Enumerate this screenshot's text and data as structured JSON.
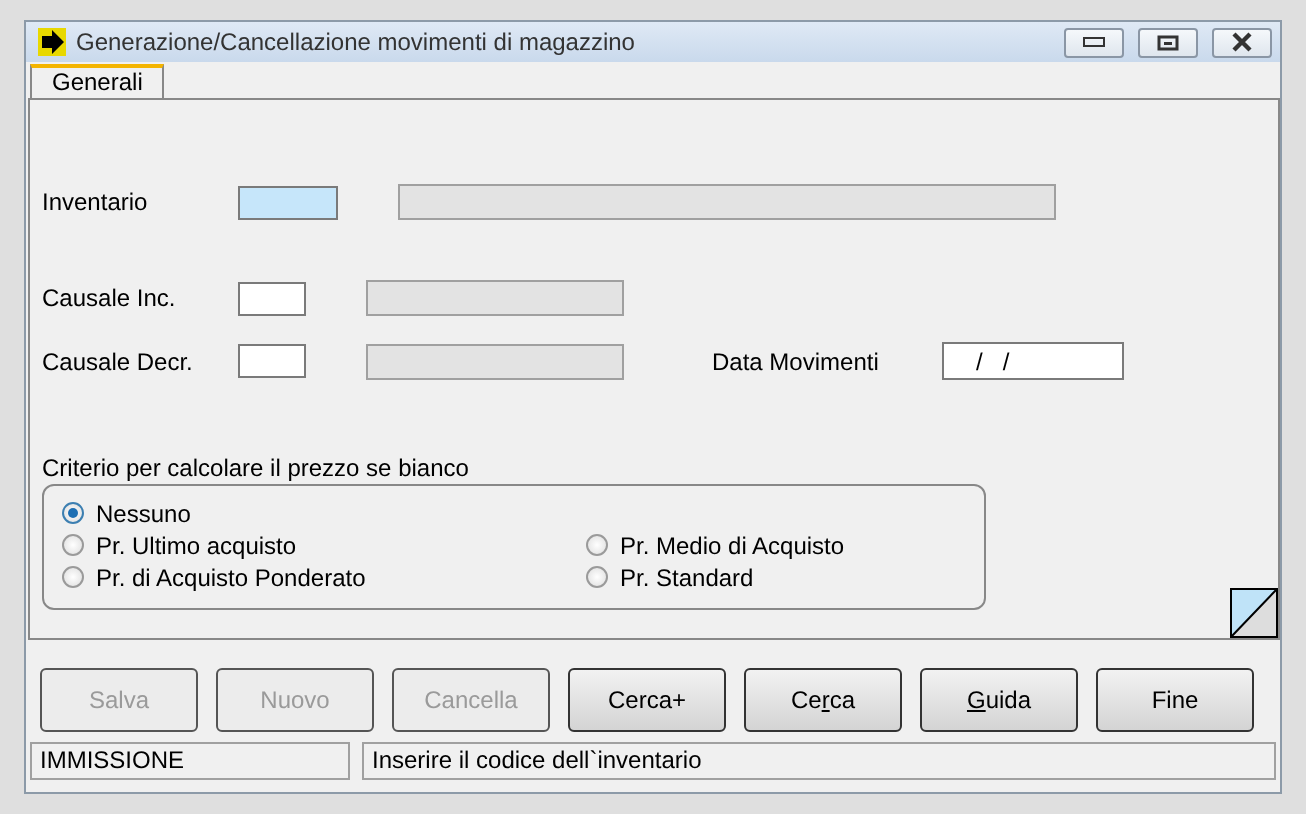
{
  "window": {
    "title": "Generazione/Cancellazione movimenti di magazzino"
  },
  "tabs": [
    {
      "label": "Generali",
      "selected": true
    }
  ],
  "fields": [
    {
      "label": "Inventario",
      "kind": "code"
    },
    {
      "label": "Causale Inc.",
      "kind": "short"
    },
    {
      "label": "Causale Decr.",
      "kind": "short",
      "date_label": "Data Movimenti",
      "date_value": "/   /"
    }
  ],
  "criterio": {
    "title": "Criterio per calcolare il prezzo se bianco",
    "options": [
      {
        "label": "Nessuno",
        "selected": true
      },
      {
        "label": "Pr. Ultimo acquisto",
        "selected": false
      },
      {
        "label": "Pr. Medio di Acquisto",
        "selected": false
      },
      {
        "label": "Pr. di Acquisto Ponderato",
        "selected": false
      },
      {
        "label": "Pr. Standard",
        "selected": false
      }
    ]
  },
  "buttons": [
    {
      "label": "Salva",
      "disabled": true
    },
    {
      "label": "Nuovo",
      "disabled": true
    },
    {
      "label": "Cancella",
      "disabled": true
    },
    {
      "label": "Cerca+",
      "disabled": false
    },
    {
      "text_before": "Ce",
      "mnemonic": "r",
      "text_after": "ca",
      "disabled": false
    },
    {
      "mnemonic": "G",
      "text_after": "uida",
      "disabled": false
    },
    {
      "label": "Fine",
      "disabled": false
    }
  ],
  "status_bar": {
    "mode": "IMMISSIONE",
    "message": "Inserire il codice dell`inventario"
  }
}
